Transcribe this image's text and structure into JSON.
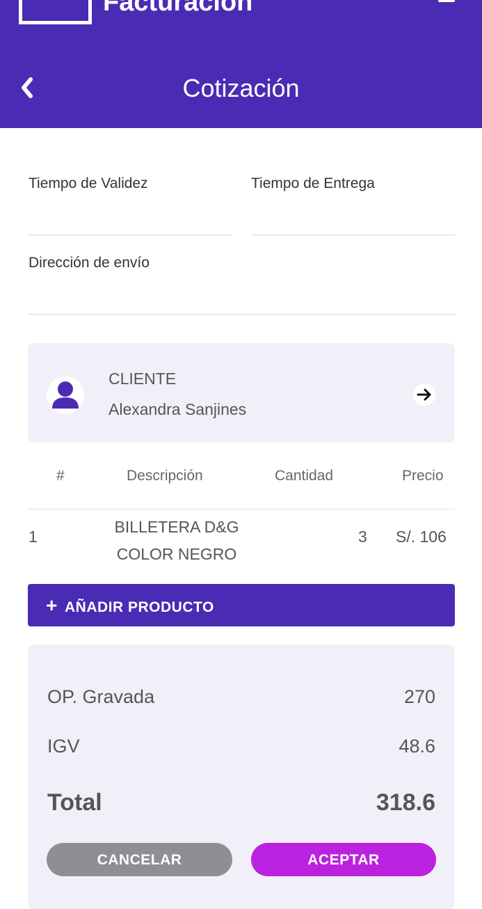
{
  "header": {
    "app_title": "Facturación",
    "page_title": "Cotización",
    "colors": {
      "primary": "#4a2cb4",
      "accent": "#bb22e0"
    }
  },
  "form": {
    "validity_label": "Tiempo de Validez",
    "delivery_label": "Tiempo de Entrega",
    "address_label": "Dirección de envío"
  },
  "client": {
    "label": "CLIENTE",
    "name": "Alexandra Sanjines"
  },
  "table": {
    "headers": [
      "#",
      "Descripción",
      "Cantidad",
      "Precio"
    ],
    "rows": [
      {
        "index": "1",
        "description_line1": "BILLETERA D&G",
        "description_line2": "COLOR NEGRO",
        "quantity": "3",
        "price": "S/. 106"
      }
    ]
  },
  "add_product_label": "AÑADIR PRODUCTO",
  "summary": {
    "gravada_label": "OP. Gravada",
    "gravada_value": "270",
    "igv_label": "IGV",
    "igv_value": "48.6",
    "total_label": "Total",
    "total_value": "318.6"
  },
  "actions": {
    "cancel_label": "CANCELAR",
    "accept_label": "ACEPTAR"
  },
  "icons": [
    "menu-icon",
    "back-arrow-icon",
    "person-icon",
    "arrow-right-icon",
    "plus-icon"
  ]
}
